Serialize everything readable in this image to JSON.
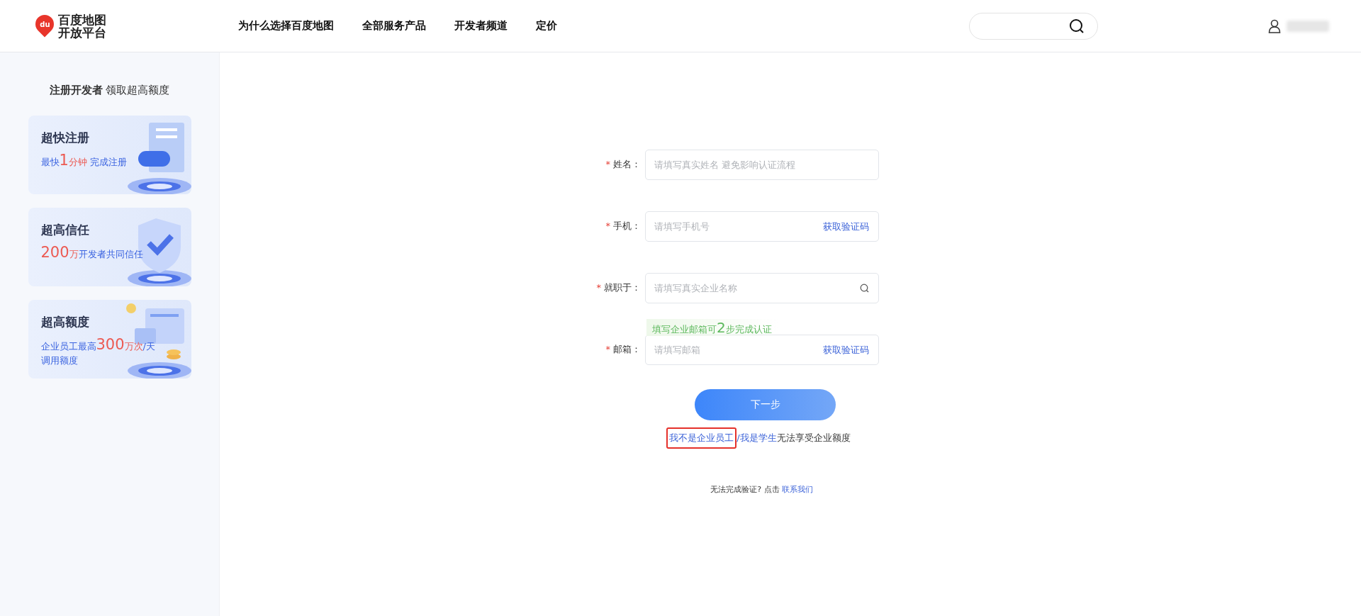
{
  "header": {
    "logo": {
      "badge": "du",
      "line_1": "百度地图",
      "line_2": "开放平台"
    },
    "nav": [
      {
        "label": "为什么选择百度地图"
      },
      {
        "label": "全部服务产品"
      },
      {
        "label": "开发者频道"
      },
      {
        "label": "定价"
      }
    ]
  },
  "sidebar": {
    "title": "注册开发者",
    "subtitle": "领取超高额度",
    "cards": [
      {
        "title": "超快注册",
        "kind": "document",
        "lines": [
          [
            {
              "text": "最快",
              "kind": "plain"
            },
            {
              "text": "1",
              "kind": "number"
            },
            {
              "text": "分钟",
              "kind": "unit"
            },
            {
              "text": " 完成注册",
              "kind": "plain"
            }
          ]
        ]
      },
      {
        "title": "超高信任",
        "kind": "shield",
        "lines": [
          [
            {
              "text": "200",
              "kind": "number"
            },
            {
              "text": "万",
              "kind": "unit"
            },
            {
              "text": "开发者共同信任",
              "kind": "plain"
            }
          ]
        ]
      },
      {
        "title": "超高额度",
        "kind": "coins",
        "lines": [
          [
            {
              "text": "企业员工最高",
              "kind": "plain"
            },
            {
              "text": "300",
              "kind": "number"
            },
            {
              "text": "万次",
              "kind": "unit"
            },
            {
              "text": "/天",
              "kind": "plain"
            }
          ],
          [
            {
              "text": "调用额度",
              "kind": "plain"
            }
          ]
        ]
      }
    ]
  },
  "form": {
    "fields": [
      {
        "label": "姓名：",
        "required_mark": "*",
        "placeholder": "请填写真实姓名 避免影响认证流程",
        "kind": "text"
      },
      {
        "label": "手机：",
        "required_mark": "*",
        "placeholder": "请填写手机号",
        "kind": "code",
        "action": "获取验证码"
      },
      {
        "label": "就职于：",
        "required_mark": "*",
        "placeholder": "请填写真实企业名称",
        "kind": "search"
      },
      {
        "label": "邮箱：",
        "required_mark": "*",
        "placeholder": "请填写邮箱",
        "kind": "code",
        "action": "获取验证码",
        "hint": [
          {
            "text": "填写企业邮箱可",
            "kind": "plain"
          },
          {
            "text": "2",
            "kind": "number"
          },
          {
            "text": "步完成认证",
            "kind": "plain"
          }
        ]
      }
    ],
    "submit": "下一步",
    "alt_links": [
      {
        "text": "我不是企业员工",
        "highlighted": true
      },
      {
        "text": "/我是学生",
        "highlighted": false
      }
    ],
    "alt_note": "无法享受企业额度",
    "help": {
      "text": "无法完成验证? 点击 ",
      "link": "联系我们"
    }
  }
}
